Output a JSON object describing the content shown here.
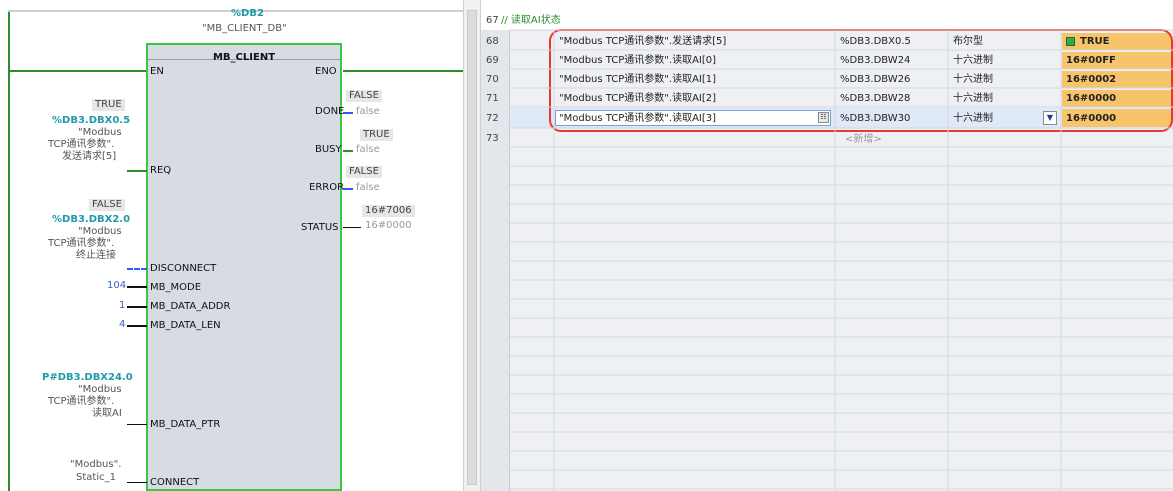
{
  "fb": {
    "db_addr": "%DB2",
    "db_name": "\"MB_CLIENT_DB\"",
    "block_name": "MB_CLIENT",
    "en": "EN",
    "eno": "ENO",
    "inputs": {
      "req": {
        "pin": "REQ",
        "value": "TRUE",
        "addr": "%DB3.DBX0.5",
        "sym1": "\"Modbus",
        "sym2": "TCP通讯参数\".",
        "sym3": "发送请求[5]"
      },
      "disconnect": {
        "pin": "DISCONNECT",
        "value": "FALSE",
        "addr": "%DB3.DBX2.0",
        "sym1": "\"Modbus",
        "sym2": "TCP通讯参数\".",
        "sym3": "终止连接"
      },
      "mb_mode": {
        "pin": "MB_MODE",
        "value": "104"
      },
      "mb_data_addr": {
        "pin": "MB_DATA_ADDR",
        "value": "1"
      },
      "mb_data_len": {
        "pin": "MB_DATA_LEN",
        "value": "4"
      },
      "mb_data_ptr": {
        "pin": "MB_DATA_PTR",
        "addr": "P#DB3.DBX24.0",
        "sym1": "\"Modbus",
        "sym2": "TCP通讯参数\".",
        "sym3": "读取AI"
      },
      "connect": {
        "pin": "CONNECT",
        "sym1": "\"Modbus\".",
        "sym2": "Static_1"
      }
    },
    "outputs": {
      "done": {
        "pin": "DONE",
        "live": "FALSE",
        "value": "false"
      },
      "busy": {
        "pin": "BUSY",
        "live": "TRUE",
        "value": "false"
      },
      "error": {
        "pin": "ERROR",
        "live": "FALSE",
        "value": "false"
      },
      "status": {
        "pin": "STATUS",
        "live": "16#7006",
        "value": "16#0000"
      }
    }
  },
  "watch": {
    "header_row": "67",
    "comment": "// 读取AI状态",
    "rows": [
      {
        "num": "68",
        "name": "\"Modbus TCP通讯参数\".发送请求[5]",
        "addr": "%DB3.DBX0.5",
        "format": "布尔型",
        "value": "TRUE"
      },
      {
        "num": "69",
        "name": "\"Modbus TCP通讯参数\".读取AI[0]",
        "addr": "%DB3.DBW24",
        "format": "十六进制",
        "value": "16#00FF"
      },
      {
        "num": "70",
        "name": "\"Modbus TCP通讯参数\".读取AI[1]",
        "addr": "%DB3.DBW26",
        "format": "十六进制",
        "value": "16#0002"
      },
      {
        "num": "71",
        "name": "\"Modbus TCP通讯参数\".读取AI[2]",
        "addr": "%DB3.DBW28",
        "format": "十六进制",
        "value": "16#0000"
      },
      {
        "num": "72",
        "name": "\"Modbus TCP通讯参数\".读取AI[3]",
        "addr": "%DB3.DBW30",
        "format": "十六进制",
        "value": "16#0000"
      }
    ],
    "new_row_num": "73",
    "add_new": "<新增>"
  },
  "colors": {
    "wire": "#2e8b2e",
    "highlight": "#e8392e",
    "value_bg": "#f7c46c"
  }
}
